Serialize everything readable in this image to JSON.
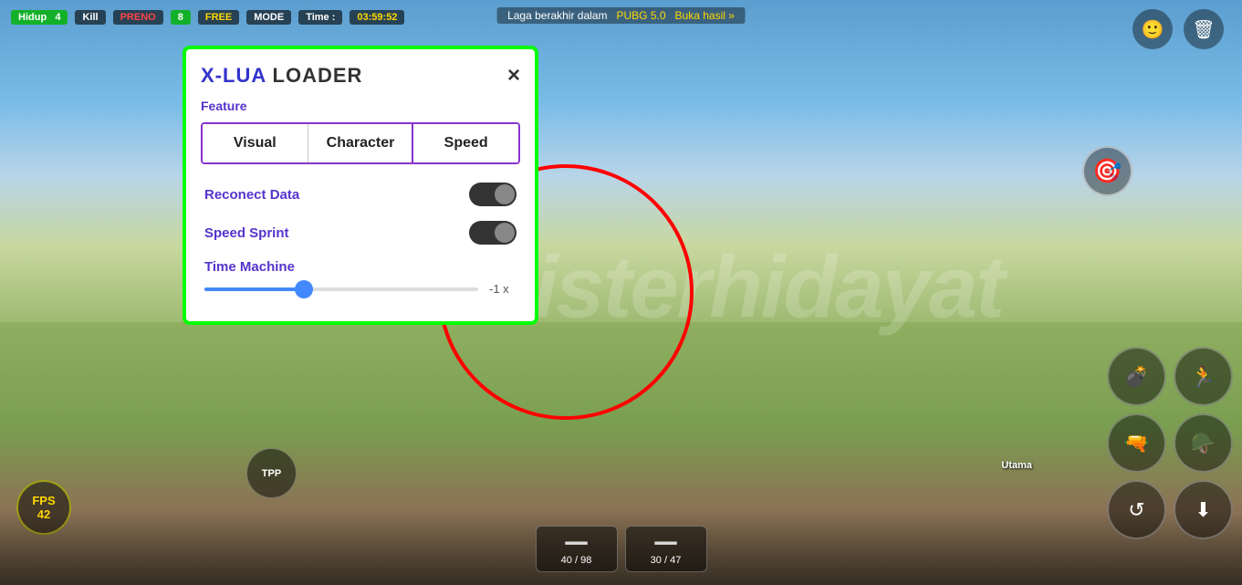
{
  "game": {
    "hud_top": {
      "hidup_label": "Hidup",
      "hidup_value": "4",
      "kill_label": "Kill",
      "kill_value": "Kill",
      "preno_label": "PRENO",
      "score": "8",
      "mode_label": "FREE",
      "mode_value": "MODE",
      "time_label": "Time :",
      "time_value": "03:59:52"
    },
    "center_message": "Laga berakhir dalam",
    "center_highlight": "PUBG 5.0",
    "center_cta": "Buka hasil »",
    "fps_label": "FPS",
    "fps_value": "42",
    "watermark": "misterhidayat",
    "tpp_label": "TPP",
    "utama_label": "Utama",
    "weapon_slots": [
      {
        "ammo": "40 / 98",
        "type": "rifle"
      },
      {
        "ammo": "30 / 47",
        "type": "ak"
      }
    ]
  },
  "modal": {
    "title_prefix": "X-LUA ",
    "title_main": "LOADER",
    "close_label": "×",
    "section_label": "Feature",
    "tabs": [
      {
        "id": "visual",
        "label": "Visual",
        "active": false
      },
      {
        "id": "character",
        "label": "Character",
        "active": false
      },
      {
        "id": "speed",
        "label": "Speed",
        "active": true
      }
    ],
    "toggles": [
      {
        "id": "reconnect",
        "label": "Reconect Data",
        "enabled": true
      },
      {
        "id": "speed_sprint",
        "label": "Speed Sprint",
        "enabled": true
      }
    ],
    "slider": {
      "label": "Time Machine",
      "value": "-1 x",
      "percent": 35
    }
  }
}
